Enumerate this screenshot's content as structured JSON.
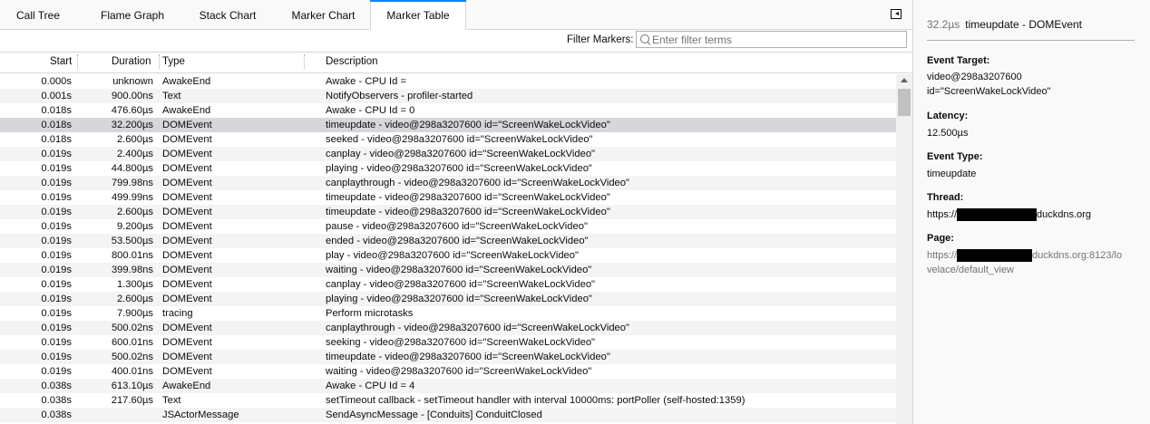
{
  "tabs": [
    {
      "label": "Call Tree",
      "active": false
    },
    {
      "label": "Flame Graph",
      "active": false
    },
    {
      "label": "Stack Chart",
      "active": false
    },
    {
      "label": "Marker Chart",
      "active": false
    },
    {
      "label": "Marker Table",
      "active": true
    }
  ],
  "filter": {
    "label": "Filter Markers:",
    "placeholder": "Enter filter terms",
    "value": ""
  },
  "table": {
    "columns": [
      "Start",
      "Duration",
      "Type",
      "Description"
    ],
    "selected_index": 3,
    "rows": [
      {
        "start": "0.000s",
        "duration": "unknown",
        "type": "AwakeEnd",
        "description": "Awake - CPU Id ="
      },
      {
        "start": "0.001s",
        "duration": "900.00ns",
        "type": "Text",
        "description": "NotifyObservers - profiler-started"
      },
      {
        "start": "0.018s",
        "duration": "476.60µs",
        "type": "AwakeEnd",
        "description": "Awake - CPU Id = 0"
      },
      {
        "start": "0.018s",
        "duration": "32.200µs",
        "type": "DOMEvent",
        "description": "timeupdate - video@298a3207600 id=\"ScreenWakeLockVideo\""
      },
      {
        "start": "0.018s",
        "duration": "2.600µs",
        "type": "DOMEvent",
        "description": "seeked - video@298a3207600 id=\"ScreenWakeLockVideo\""
      },
      {
        "start": "0.019s",
        "duration": "2.400µs",
        "type": "DOMEvent",
        "description": "canplay - video@298a3207600 id=\"ScreenWakeLockVideo\""
      },
      {
        "start": "0.019s",
        "duration": "44.800µs",
        "type": "DOMEvent",
        "description": "playing - video@298a3207600 id=\"ScreenWakeLockVideo\""
      },
      {
        "start": "0.019s",
        "duration": "799.98ns",
        "type": "DOMEvent",
        "description": "canplaythrough - video@298a3207600 id=\"ScreenWakeLockVideo\""
      },
      {
        "start": "0.019s",
        "duration": "499.99ns",
        "type": "DOMEvent",
        "description": "timeupdate - video@298a3207600 id=\"ScreenWakeLockVideo\""
      },
      {
        "start": "0.019s",
        "duration": "2.600µs",
        "type": "DOMEvent",
        "description": "timeupdate - video@298a3207600 id=\"ScreenWakeLockVideo\""
      },
      {
        "start": "0.019s",
        "duration": "9.200µs",
        "type": "DOMEvent",
        "description": "pause - video@298a3207600 id=\"ScreenWakeLockVideo\""
      },
      {
        "start": "0.019s",
        "duration": "53.500µs",
        "type": "DOMEvent",
        "description": "ended - video@298a3207600 id=\"ScreenWakeLockVideo\""
      },
      {
        "start": "0.019s",
        "duration": "800.01ns",
        "type": "DOMEvent",
        "description": "play - video@298a3207600 id=\"ScreenWakeLockVideo\""
      },
      {
        "start": "0.019s",
        "duration": "399.98ns",
        "type": "DOMEvent",
        "description": "waiting - video@298a3207600 id=\"ScreenWakeLockVideo\""
      },
      {
        "start": "0.019s",
        "duration": "1.300µs",
        "type": "DOMEvent",
        "description": "canplay - video@298a3207600 id=\"ScreenWakeLockVideo\""
      },
      {
        "start": "0.019s",
        "duration": "2.600µs",
        "type": "DOMEvent",
        "description": "playing - video@298a3207600 id=\"ScreenWakeLockVideo\""
      },
      {
        "start": "0.019s",
        "duration": "7.900µs",
        "type": "tracing",
        "description": "Perform microtasks"
      },
      {
        "start": "0.019s",
        "duration": "500.02ns",
        "type": "DOMEvent",
        "description": "canplaythrough - video@298a3207600 id=\"ScreenWakeLockVideo\""
      },
      {
        "start": "0.019s",
        "duration": "600.01ns",
        "type": "DOMEvent",
        "description": "seeking - video@298a3207600 id=\"ScreenWakeLockVideo\""
      },
      {
        "start": "0.019s",
        "duration": "500.02ns",
        "type": "DOMEvent",
        "description": "timeupdate - video@298a3207600 id=\"ScreenWakeLockVideo\""
      },
      {
        "start": "0.019s",
        "duration": "400.01ns",
        "type": "DOMEvent",
        "description": "waiting - video@298a3207600 id=\"ScreenWakeLockVideo\""
      },
      {
        "start": "0.038s",
        "duration": "613.10µs",
        "type": "AwakeEnd",
        "description": "Awake - CPU Id = 4"
      },
      {
        "start": "0.038s",
        "duration": "217.60µs",
        "type": "Text",
        "description": "setTimeout callback - setTimeout handler with interval 10000ms: portPoller (self-hosted:1359)"
      },
      {
        "start": "0.038s",
        "duration": "",
        "type": "JSActorMessage",
        "description": "SendAsyncMessage - [Conduits] ConduitClosed"
      }
    ]
  },
  "sidebar": {
    "duration": "32.2µs",
    "name": "timeupdate - DOMEvent",
    "event_target_label": "Event Target:",
    "event_target_line1": "video@298a3207600",
    "event_target_line2": "id=\"ScreenWakeLockVideo\"",
    "latency_label": "Latency:",
    "latency_value": "12.500µs",
    "event_type_label": "Event Type:",
    "event_type_value": "timeupdate",
    "thread_label": "Thread:",
    "thread_prefix": "https://",
    "thread_suffix": "duckdns.org",
    "page_label": "Page:",
    "page_prefix": "https://",
    "page_suffix": "duckdns.org:8123/lo",
    "page_line2": "velace/default_view"
  },
  "colors": {
    "accent": "#0a84ff",
    "selected_row": "#d7d7db",
    "muted_text": "#737373"
  }
}
